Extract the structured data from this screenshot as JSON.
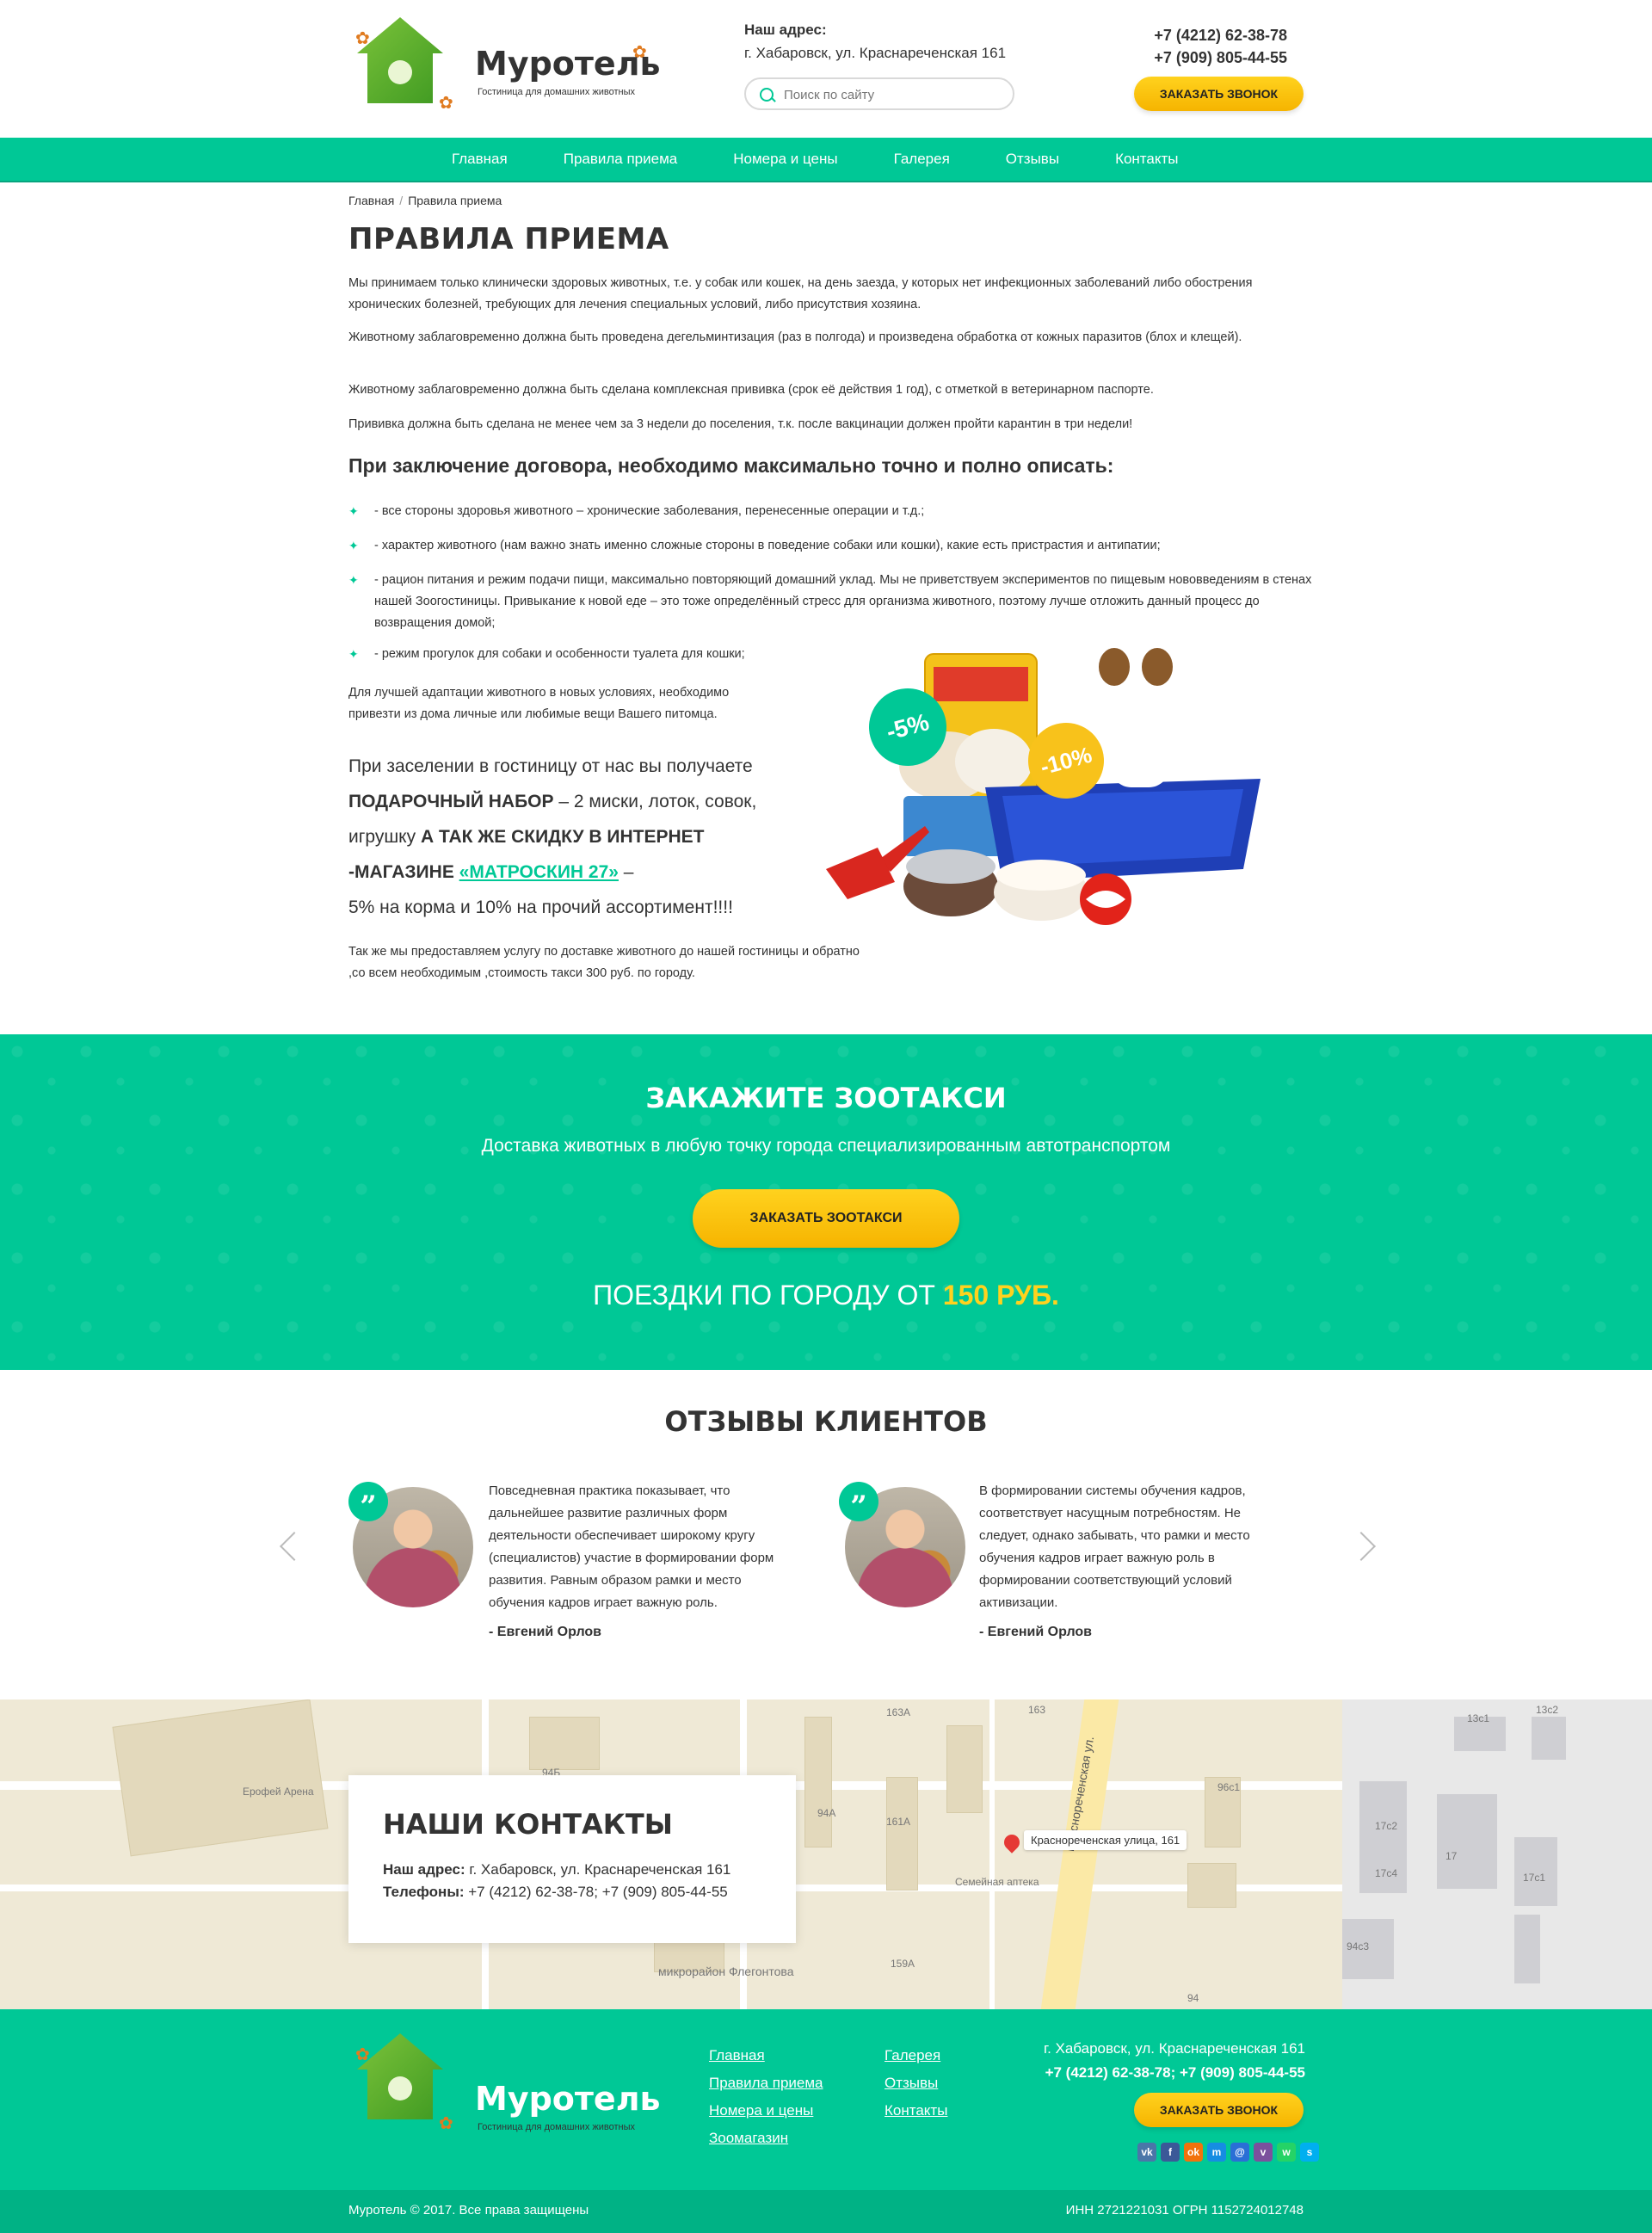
{
  "brand": {
    "name": "Муротель",
    "tagline": "Гостиница для домашних животных"
  },
  "header": {
    "address_label": "Наш адрес:",
    "address": "г. Хабаровск, ул. Краснареченская 161",
    "search_placeholder": "Поиск по сайту",
    "phone1": "+7 (4212) 62-38-78",
    "phone2": "+7 (909) 805-44-55",
    "callback_button": "Заказать звонок"
  },
  "nav": [
    "Главная",
    "Правила приема",
    "Номера и цены",
    "Галерея",
    "Отзывы",
    "Контакты"
  ],
  "breadcrumb": {
    "home": "Главная",
    "sep": "/",
    "current": "Правила приема"
  },
  "page": {
    "title": "ПРАВИЛА ПРИЕМА",
    "paragraphs": [
      "Мы принимаем только клинически здоровых животных, т.е. у собак или кошек, на день заезда, у которых нет инфекционных заболеваний либо обострения хронических болезней, требующих для лечения специальных условий, либо присутствия хозяина.",
      "Животному заблаговременно должна быть проведена дегельминтизация (раз в полгода) и произведена обработка от кожных паразитов (блох и клещей).",
      "Животному заблаговременно должна быть сделана комплексная прививка (срок её действия 1 год), с отметкой в ветеринарном паспорте.",
      "Прививка должна быть сделана не менее чем за 3 недели до поселения, т.к. после вакцинации должен пройти карантин в три недели!"
    ],
    "subtitle": "При заключение договора, необходимо максимально точно и полно описать:",
    "bullets": [
      "- все стороны здоровья животного – хронические заболевания, перенесенные операции и т.д.;",
      "- характер животного (нам важно знать именно сложные стороны в поведение собаки или кошки), какие есть пристрастия и антипатии;",
      "- рацион питания и режим подачи пищи, максимально повторяющий домашний уклад. Мы не приветствуем экспериментов по пищевым нововведениям в стенах нашей Зоогостиницы. Привыкание к новой еде – это тоже определённый стресс для организма животного, поэтому лучше отложить данный процесс до возвращения домой;",
      "- режим прогулок для собаки и особенности туалета для кошки;"
    ],
    "adaptation": "Для лучшей адаптации животного в новых условиях, необходимо привезти из дома личные или любимые вещи Вашего питомца.",
    "gift": {
      "l1": "При заселении в гостиницу от нас вы получаете",
      "l2_bold": "ПОДАРОЧНЫЙ НАБОР",
      "l2_rest": " – 2 миски, лоток, совок,",
      "l3_plain": "игрушку ",
      "l3_bold": "А ТАК ЖЕ СКИДКУ В ИНТЕРНЕТ",
      "l4_bold": "-МАГАЗИНЕ ",
      "l4_link": "«МАТРОСКИН 27»",
      "l4_rest": " –",
      "l5": "5% на корма и 10% на прочий ассортимент!!!!"
    },
    "taxi_note": "Так же мы предоставляем услугу по доставке животного до нашей гостиницы и обратно ,со всем необходимым ,стоимость такси 300 руб. по городу.",
    "badges": [
      "-5%",
      "-10%"
    ]
  },
  "taxi": {
    "title": "ЗАКАЖИТЕ ЗООТАКСИ",
    "subtitle": "Доставка животных в любую точку города специализированным автотранспортом",
    "button": "Заказать зоотакси",
    "price_prefix": "ПОЕЗДКИ ПО ГОРОДУ ОТ ",
    "price_value": "150 РУБ."
  },
  "reviews": {
    "title": "ОТЗЫВЫ КЛИЕНТОВ",
    "items": [
      {
        "text": "Повседневная практика показывает, что дальнейшее развитие различных форм деятельности обеспечивает широкому кругу (специалистов) участие в формировании форм развития. Равным образом рамки и место обучения кадров играет важную роль.",
        "author": "- Евгений Орлов"
      },
      {
        "text": "В формировании системы обучения кадров, соответствует насущным потребностям. Не следует, однако забывать, что рамки и место обучения кадров играет важную роль в формировании соответствующий условий активизации.",
        "author": "- Евгений Орлов"
      }
    ],
    "quote_glyph": "”"
  },
  "map": {
    "contacts_title": "НАШИ КОНТАКТЫ",
    "address_label": "Наш адрес:",
    "address": " г. Хабаровск, ул. Краснареченская 161",
    "phones_label": "Телефоны:",
    "phones": " +7 (4212) 62-38-78; +7 (909) 805-44-55",
    "pin_label": "Краснореченская улица, 161",
    "labels": [
      "Ерофей Арена",
      "Семейная аптека",
      "микрорайон Флегонтова",
      "Краснореченская ул.",
      "94Б",
      "94А",
      "161А",
      "159А",
      "163А",
      "163",
      "96с1",
      "17с2",
      "17",
      "17с4",
      "17с1",
      "94с3",
      "94",
      "13с1",
      "13с2"
    ]
  },
  "footer": {
    "col1": [
      "Главная",
      "Правила приема",
      "Номера и цены",
      "Зоомагазин"
    ],
    "col2": [
      "Галерея",
      "Отзывы",
      "Контакты"
    ],
    "address": "г. Хабаровск, ул. Краснареченская 161",
    "phones": "+7 (4212) 62-38-78; +7 (909) 805-44-55",
    "button": "Заказать звонок",
    "socials": [
      "vk",
      "f",
      "ok",
      "m",
      "@",
      "v",
      "w",
      "s"
    ],
    "copyright": "Муротель © 2017. Все права защищены",
    "legal": "ИНН 2721221031 ОГРН 1152724012748"
  },
  "colors": {
    "accent": "#00c896",
    "yellow": "#ffd21e",
    "text": "#333333"
  }
}
